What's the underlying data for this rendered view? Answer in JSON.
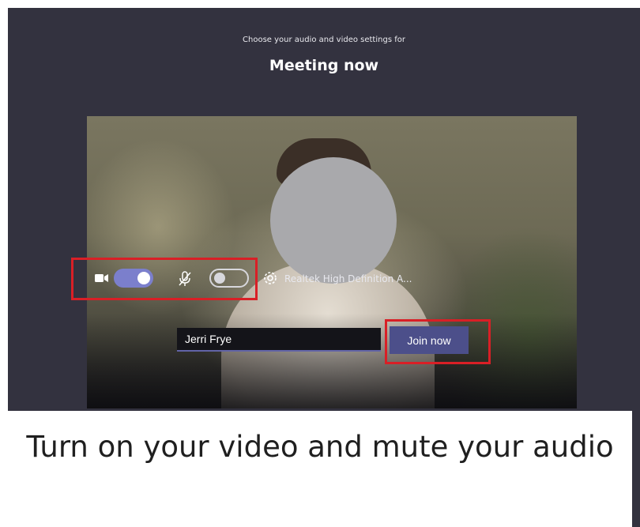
{
  "header": {
    "subtitle": "Choose your audio and video settings for",
    "title": "Meeting now"
  },
  "prejoin": {
    "name_value": "Jerri Frye",
    "join_label": "Join now"
  },
  "controls": {
    "camera_toggle_on": true,
    "mic_toggle_on": false,
    "audio_device": "Realtek High Definition A..."
  },
  "caption": {
    "text": "Turn on your video and mute your audio"
  },
  "colors": {
    "app_background": "#33323f",
    "accent": "#6264a7",
    "highlight_red": "#d91f26"
  },
  "icons": [
    "camera-icon",
    "microphone-off-icon",
    "gear-icon"
  ]
}
